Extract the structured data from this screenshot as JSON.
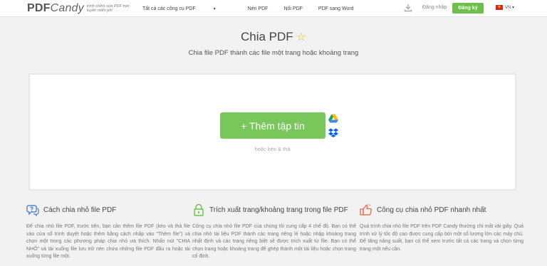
{
  "header": {
    "logo_main": "PDF",
    "logo_candy": "Candy",
    "logo_tagline": "trình chỉnh sửa PDF trực tuyến miễn phí",
    "nav": [
      {
        "label": "Tất cả các công cụ PDF"
      },
      {
        "label": "Nén PDF"
      },
      {
        "label": "Nối PDF"
      },
      {
        "label": "PDF sang Word"
      }
    ],
    "download_icon": "download-icon",
    "login_label": "Đăng nhập",
    "register_label": "Đăng ký",
    "language": "VN"
  },
  "main": {
    "title": "Chia PDF",
    "subtitle": "Chia file PDF thành các file một trang hoặc khoảng trang",
    "upload": {
      "button_label": "+ Thêm tập tin",
      "drag_hint": "hoặc kéo & thả"
    }
  },
  "columns": [
    {
      "icon": "chat-question-icon",
      "title": "Cách chia nhỏ file PDF",
      "text": "Để chia nhỏ file PDF, trước tiên, bạn cần thêm file PDF (kéo và thả file vào cửa sổ trình duyệt hoặc thêm bằng cách nhấp vào \"Thêm file\") và chọn một trong các phương pháp chia nhỏ ưa thích. Nhấn nút \"CHIA NHỎ\" và tải xuống file lưu trữ nén chứa những file PDF đầu ra hoặc tải xuống từng file một."
    },
    {
      "icon": "lock-icon",
      "title": "Trích xuất trang/khoảng trang trong file PDF",
      "text": "Công cụ chia nhỏ file PDF của chúng tôi cung cấp 4 chế độ. Bạn có thể chia nhỏ tài liệu PDF thành các trang riêng lẻ hoặc nhập khoảng trang nhất định và các trang riêng biệt sẽ được trích xuất từ file. Bạn có thể chọn trang hoặc khoảng trang để ghép thành một tài liệu hoặc chọn trang cố định."
    },
    {
      "icon": "thumbs-up-icon",
      "title": "Công cụ chia nhỏ PDF nhanh nhất",
      "text": "Quá trình chia nhỏ file PDF trên PDF Candy thường chỉ mất vài giây. Quá trình xử lý tốc độ cao được cung cấp bởi một số lượng lớn các máy chủ. Để tăng năng suất, bạn có thể xem trước tất cả các trang và chọn từng trang một nếu cần."
    }
  ],
  "colors": {
    "accent_green": "#79c65a",
    "register_green": "#6cc04a",
    "star": "#f0b400",
    "icon_orange": "#e8603c",
    "icon_blue": "#3b6fc6",
    "icon_green": "#6cc04a"
  }
}
